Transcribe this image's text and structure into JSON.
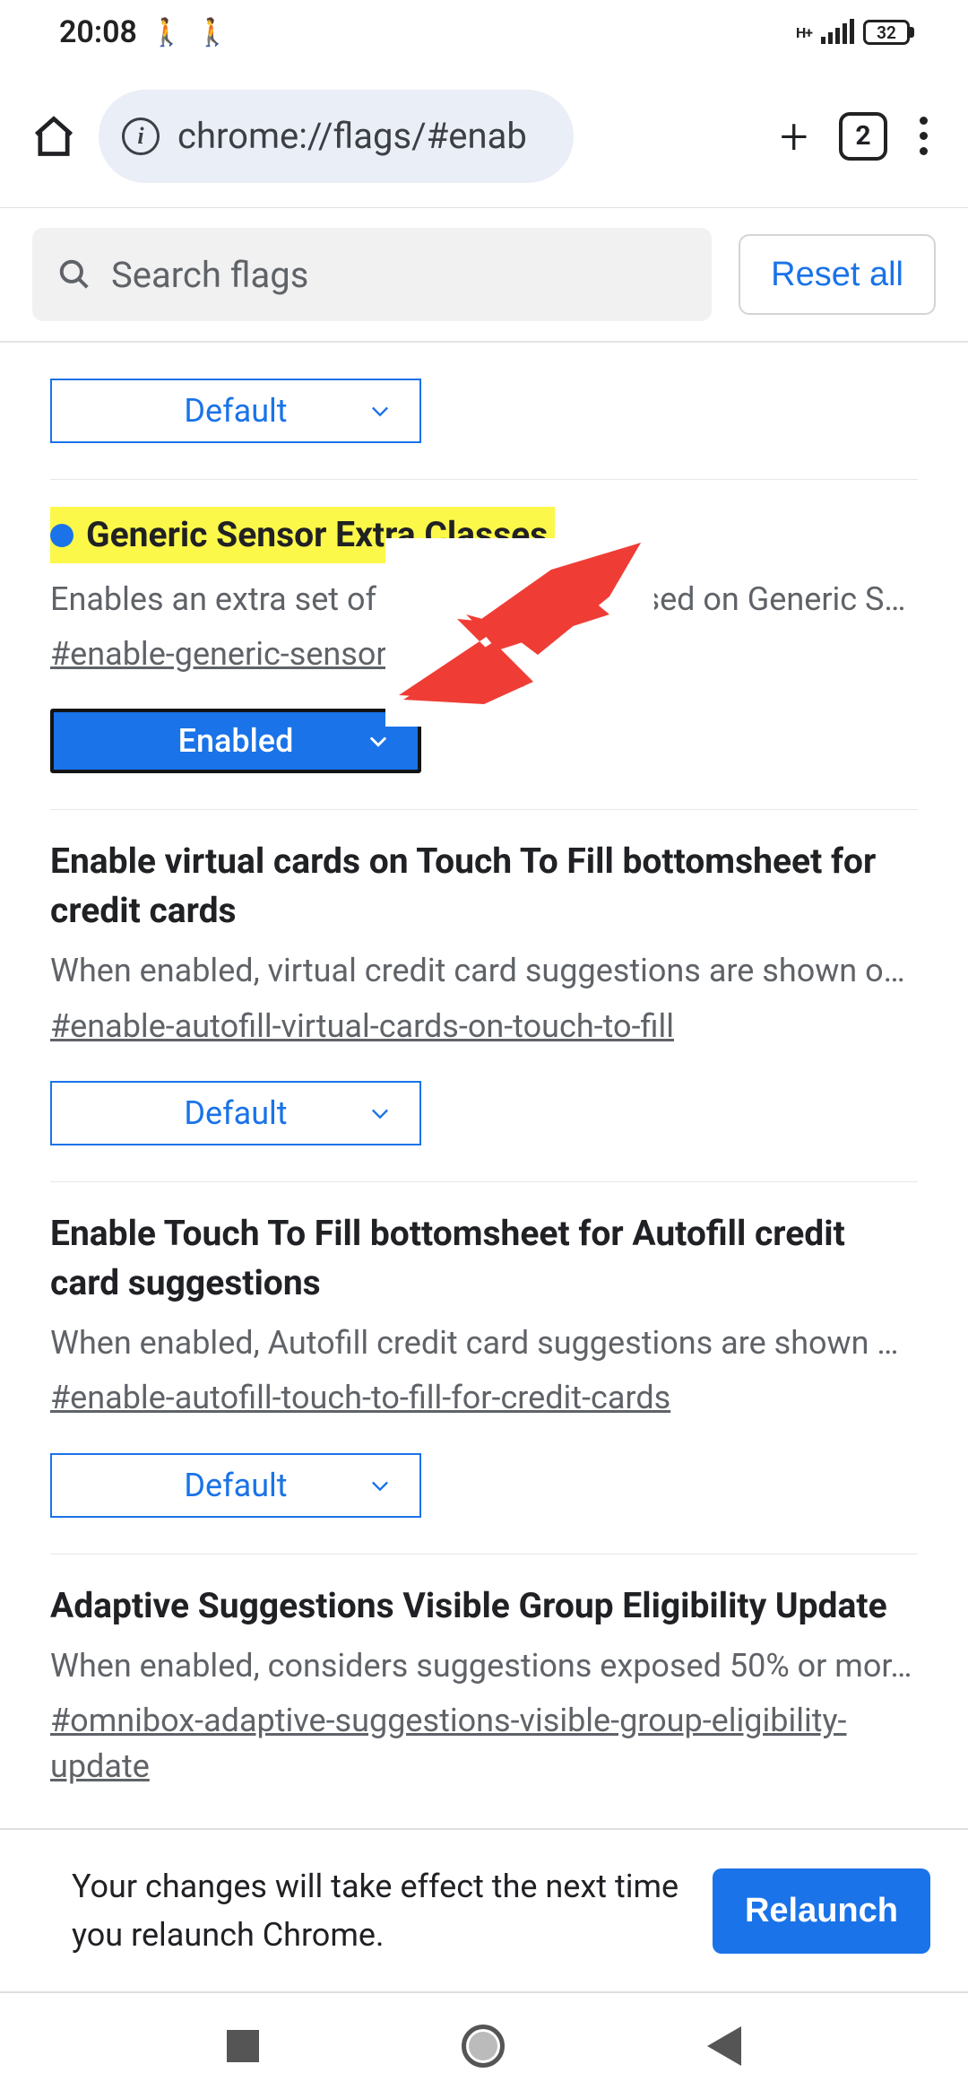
{
  "status": {
    "time": "20:08",
    "network_type": "H+",
    "battery_pct": "32"
  },
  "toolbar": {
    "url": "chrome://flags/#enab",
    "tab_count": "2"
  },
  "flags_header": {
    "search_placeholder": "Search flags",
    "reset_label": "Reset all"
  },
  "flags": [
    {
      "title": "",
      "desc": "",
      "hash": "",
      "dropdown_value": "Default",
      "highlighted": false,
      "has_dot": false,
      "style": "default"
    },
    {
      "title": "Generic Sensor Extra Classes",
      "desc": "Enables an extra set of sensor classes based on Generic S…",
      "hash": "#enable-generic-sensor-extra-classes",
      "dropdown_value": "Enabled",
      "highlighted": true,
      "has_dot": true,
      "style": "enabled"
    },
    {
      "title": "Enable virtual cards on Touch To Fill bottomsheet for credit cards",
      "desc": "When enabled, virtual credit card suggestions are shown o…",
      "hash": "#enable-autofill-virtual-cards-on-touch-to-fill",
      "dropdown_value": "Default",
      "highlighted": false,
      "has_dot": false,
      "style": "default"
    },
    {
      "title": "Enable Touch To Fill bottomsheet for Autofill credit card suggestions",
      "desc": "When enabled, Autofill credit card suggestions are shown …",
      "hash": "#enable-autofill-touch-to-fill-for-credit-cards",
      "dropdown_value": "Default",
      "highlighted": false,
      "has_dot": false,
      "style": "default"
    },
    {
      "title": "Adaptive Suggestions Visible Group Eligibility Update",
      "desc": "When enabled, considers suggestions exposed 50% or mor…",
      "hash": "#omnibox-adaptive-suggestions-visible-group-eligibility-update",
      "dropdown_value": "",
      "highlighted": false,
      "has_dot": false,
      "style": "none"
    }
  ],
  "relaunch": {
    "message": "Your changes will take effect the next time you relaunch Chrome.",
    "button": "Relaunch"
  }
}
